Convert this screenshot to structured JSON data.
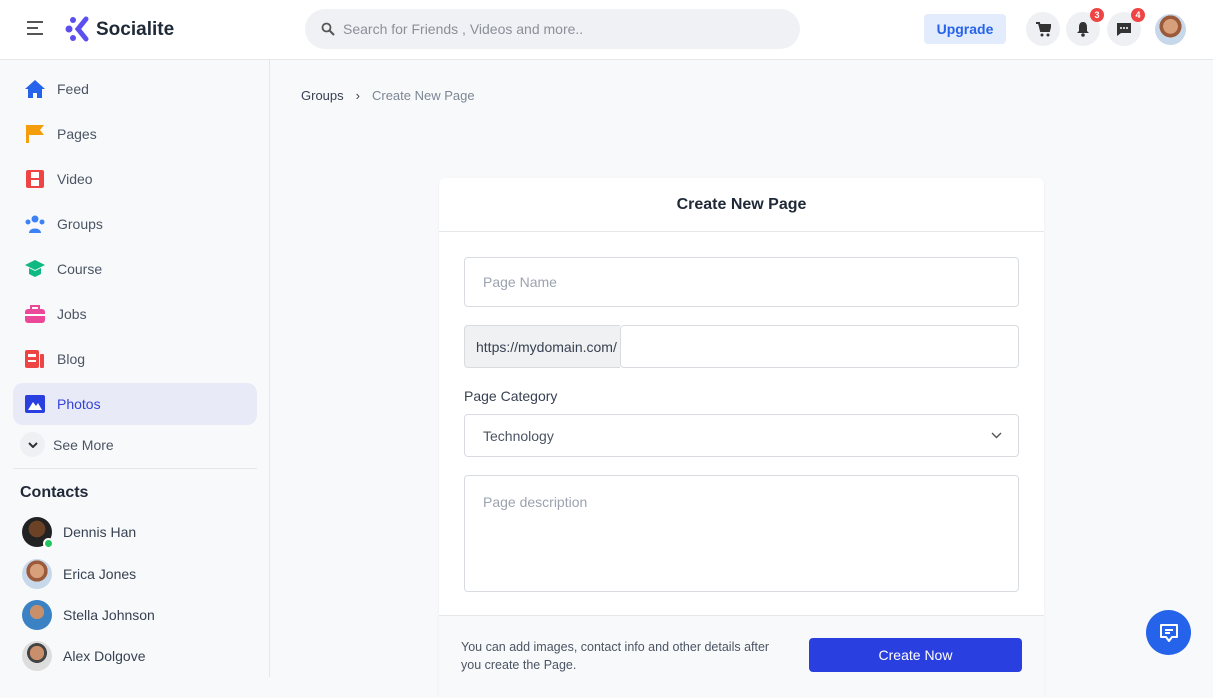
{
  "header": {
    "brand": "Socialite",
    "search_placeholder": "Search for Friends , Videos and more..",
    "upgrade": "Upgrade",
    "notifications_count": "3",
    "messages_count": "4"
  },
  "sidebar": {
    "items": [
      {
        "label": "Feed"
      },
      {
        "label": "Pages"
      },
      {
        "label": "Video"
      },
      {
        "label": "Groups"
      },
      {
        "label": "Course"
      },
      {
        "label": "Jobs"
      },
      {
        "label": "Blog"
      },
      {
        "label": "Photos"
      }
    ],
    "see_more": "See More",
    "contacts_title": "Contacts",
    "contacts": [
      {
        "name": "Dennis Han"
      },
      {
        "name": "Erica Jones"
      },
      {
        "name": "Stella Johnson"
      },
      {
        "name": "Alex Dolgove"
      }
    ]
  },
  "breadcrumb": {
    "parent": "Groups",
    "sep": "›",
    "current": "Create New Page"
  },
  "form": {
    "title": "Create New Page",
    "page_name_placeholder": "Page Name",
    "url_prefix": "https://mydomain.com/",
    "category_label": "Page Category",
    "category_value": "Technology",
    "description_placeholder": "Page description",
    "footer_note": "You can add images, contact info and other details after you create the Page.",
    "submit": "Create Now"
  },
  "colors": {
    "accent": "#2a3fe0",
    "brand": "#5b4ff0"
  }
}
